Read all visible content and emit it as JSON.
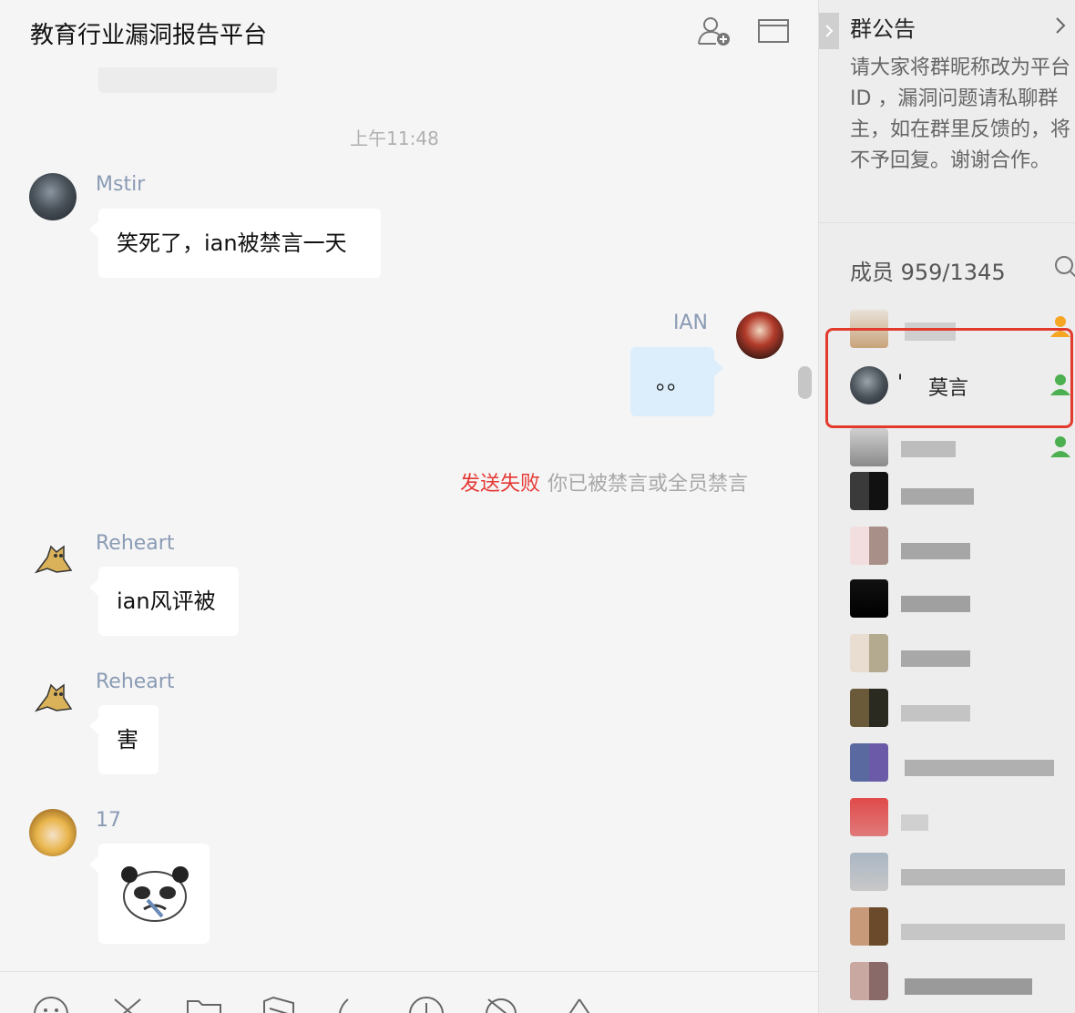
{
  "header": {
    "title": "教育行业漏洞报告平台",
    "icons": [
      "add-member-icon",
      "folder-icon"
    ]
  },
  "chat": {
    "timestamp": "上午11:48",
    "messages": [
      {
        "sender": "Mstir",
        "text": "笑死了，ian被禁言一天"
      },
      {
        "sender": "IAN",
        "text": "。。",
        "mine": true
      },
      {
        "sender": "Reheart",
        "text": "ian风评被"
      },
      {
        "sender": "Reheart",
        "text": "害"
      },
      {
        "sender": "17",
        "sticker": "panda-sticker"
      }
    ],
    "send_failed": {
      "label": "发送失败",
      "reason": "你已被禁言或全员禁言"
    }
  },
  "toolbar": {
    "icons": [
      "emoji-icon",
      "scissors-icon",
      "folder-icon",
      "screenshot-icon",
      "phone-icon",
      "clock-icon",
      "mute-icon",
      "warning-icon"
    ]
  },
  "sidebar": {
    "notice_title": "群公告",
    "notice_text": "请大家将群昵称改为平台 ID ，漏洞问题请私聊群主，如在群里反馈的，将不予回复。谢谢合作。",
    "members_label": "成员 959/1345",
    "highlighted_member": {
      "name": "莫言",
      "prefix": "'"
    }
  },
  "colors": {
    "accent_red": "#e53935",
    "sender_name": "#8a9bb5",
    "mine_bubble": "#dceefb",
    "member_badge_orange": "#f5a623",
    "member_badge_green": "#4caf50"
  }
}
